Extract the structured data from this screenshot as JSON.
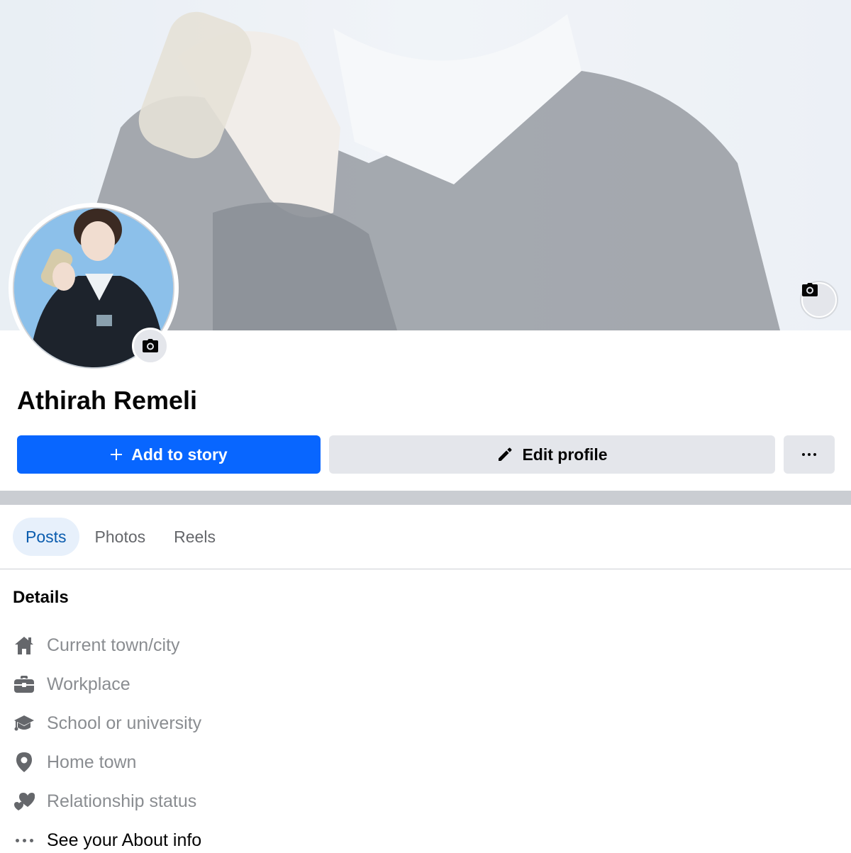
{
  "profile": {
    "name": "Athirah Remeli"
  },
  "actions": {
    "add_story_label": "Add to story",
    "edit_profile_label": "Edit profile"
  },
  "tabs": [
    {
      "label": "Posts",
      "active": true
    },
    {
      "label": "Photos",
      "active": false
    },
    {
      "label": "Reels",
      "active": false
    }
  ],
  "details": {
    "title": "Details",
    "items": [
      {
        "icon": "home-icon",
        "label": "Current town/city"
      },
      {
        "icon": "briefcase-icon",
        "label": "Workplace"
      },
      {
        "icon": "graduation-cap-icon",
        "label": "School or university"
      },
      {
        "icon": "location-pin-icon",
        "label": "Home town"
      },
      {
        "icon": "heart-icon",
        "label": "Relationship status"
      },
      {
        "icon": "more-dots-icon",
        "label": "See your About info"
      }
    ]
  },
  "colors": {
    "primary_button": "#0866ff",
    "secondary_button": "#e4e6eb",
    "active_tab_text": "#0a5cae",
    "active_tab_bg": "#e7f0fb",
    "muted_text": "#8a8d91"
  }
}
